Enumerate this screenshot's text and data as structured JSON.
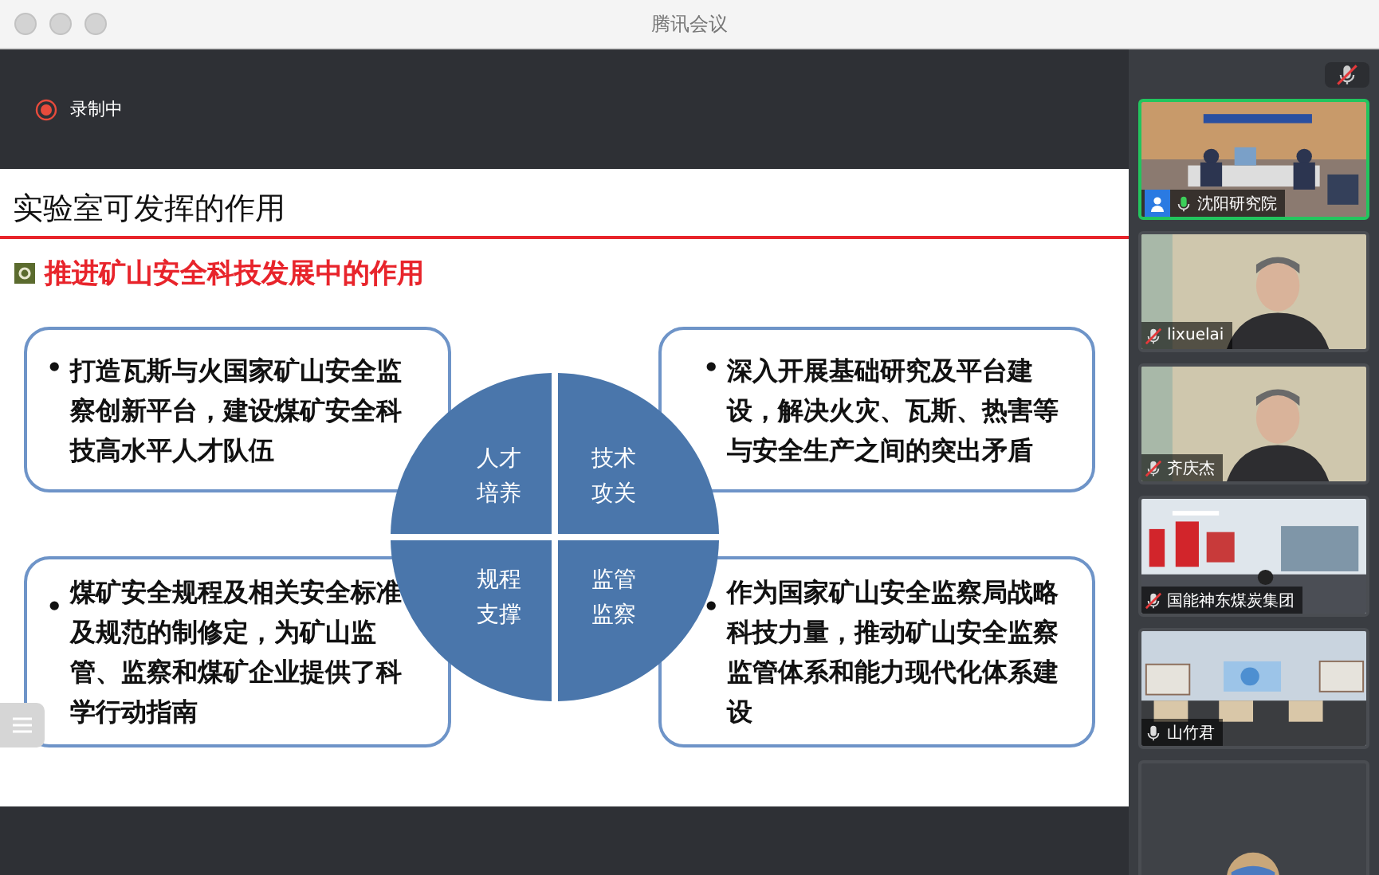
{
  "window": {
    "title": "腾讯会议"
  },
  "recording": {
    "label": "录制中",
    "on": true
  },
  "slide": {
    "title": "实验室可发挥的作用",
    "subtitle": "推进矿山安全科技发展中的作用",
    "bullet": "•",
    "boxes": [
      {
        "text": "打造瓦斯与火国家矿山安全监察创新平台，建设煤矿安全科技高水平人才队伍"
      },
      {
        "text": "深入开展基础研究及平台建设，解决火灾、瓦斯、热害等与安全生产之间的突出矛盾"
      },
      {
        "text": "煤矿安全规程及相关安全标准及规范的制修定，为矿山监管、监察和煤矿企业提供了科学行动指南"
      },
      {
        "text": "作为国家矿山安全监察局战略科技力量，推动矿山安全监察监管体系和能力现代化体系建设"
      }
    ],
    "quadrants": [
      {
        "lines": [
          "人才",
          "培养"
        ]
      },
      {
        "lines": [
          "技术",
          "攻关"
        ]
      },
      {
        "lines": [
          "规程",
          "支撑"
        ]
      },
      {
        "lines": [
          "监管",
          "监察"
        ]
      }
    ]
  },
  "mute_button": {
    "muted": true
  },
  "participants": [
    {
      "name": "沈阳研究院",
      "muted": false,
      "speaking": true,
      "highlighted": true,
      "kind": "room"
    },
    {
      "name": "lixuelai",
      "muted": true,
      "speaking": false,
      "highlighted": false,
      "kind": "person"
    },
    {
      "name": "齐庆杰",
      "muted": true,
      "speaking": false,
      "highlighted": false,
      "kind": "person"
    },
    {
      "name": "国能神东煤炭集团",
      "muted": true,
      "speaking": false,
      "highlighted": false,
      "kind": "hall"
    },
    {
      "name": "山竹君",
      "muted": false,
      "speaking": false,
      "highlighted": false,
      "kind": "office"
    },
    {
      "highlighted": false,
      "kind": "avatar"
    }
  ]
}
